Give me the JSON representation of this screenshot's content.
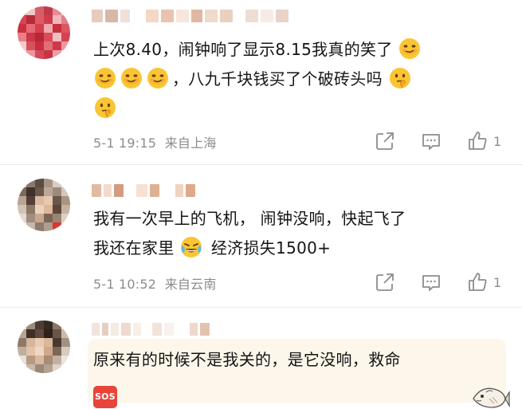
{
  "comments": [
    {
      "text_line1": "上次8.40，闹钟响了显示8.15我真的笑了",
      "text_line2": "，八九千块钱买了个破砖头吗",
      "time": "5-1 19:15",
      "location": "来自上海",
      "like_count": "1",
      "emoji": "smirk-face-icon"
    },
    {
      "text_line1": "我有一次早上的飞机， 闹钟没响，快起飞了",
      "text_line2a": "我还在家里",
      "text_line2b": "经济损失1500+",
      "time": "5-1 10:52",
      "location": "来自云南",
      "like_count": "1",
      "emoji": "crying-laughing-face-icon"
    },
    {
      "text_line1": "原来有的时候不是我关的，是它没响，救命",
      "badge": "SOS"
    }
  ],
  "colors": {
    "meta_gray": "#8c8c8c",
    "highlight_bg": "#fdf7eb",
    "sos_red": "#e8443a"
  }
}
